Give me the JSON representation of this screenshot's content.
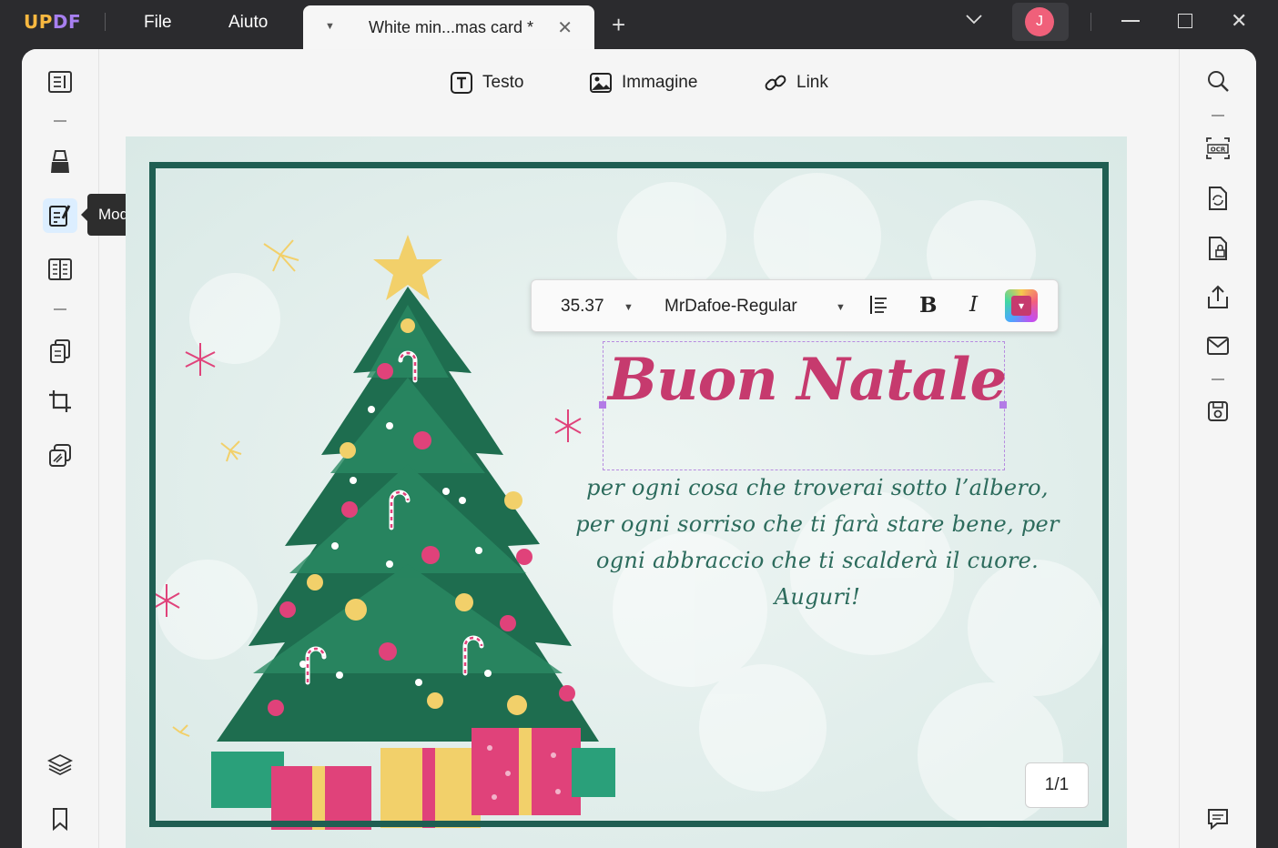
{
  "app": {
    "logo": "UPDF",
    "menu": [
      "File",
      "Aiuto"
    ],
    "tab_title": "White min...mas card *",
    "avatar_initial": "J"
  },
  "top_tools": {
    "text_label": "Testo",
    "image_label": "Immagine",
    "link_label": "Link"
  },
  "tooltip": "Modifica PDF",
  "format_toolbar": {
    "font_size": "35.37",
    "font_name": "MrDafoe-Regular",
    "bold_label": "B",
    "italic_label": "I",
    "text_color": "#c63a6e"
  },
  "card": {
    "greeting": "Buon Natale",
    "line1": "per ogni cosa che troverai sotto l’albero,",
    "line2": "per ogni sorriso che ti farà stare bene, per",
    "line3": "ogni abbraccio che ti scalderà il cuore.",
    "line4": "Auguri!"
  },
  "page_counter": "1/1",
  "colors": {
    "accent": "#a17cf0",
    "frame": "#1f5e52",
    "greeting": "#c63a6e",
    "body_text": "#2c6b5c"
  }
}
